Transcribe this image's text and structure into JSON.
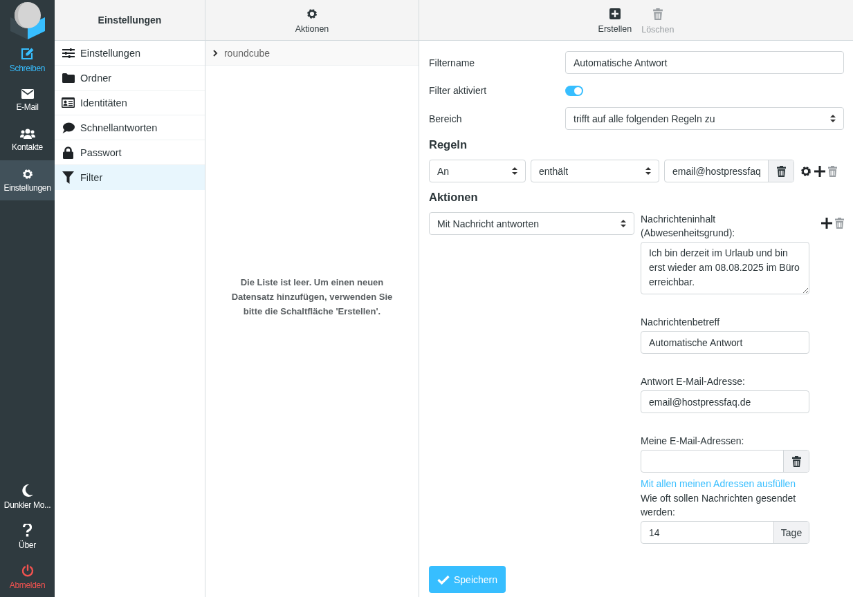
{
  "nav": {
    "top": [
      {
        "kind": "compose",
        "label": "Schreiben",
        "selected": false
      },
      {
        "kind": "mail",
        "label": "E-Mail",
        "selected": false
      },
      {
        "kind": "contacts",
        "label": "Kontakte",
        "selected": false
      },
      {
        "kind": "settings",
        "label": "Einstellungen",
        "selected": true
      }
    ],
    "bottom": [
      {
        "kind": "darkmode",
        "label": "Dunkler Mo..."
      },
      {
        "kind": "about",
        "label": "Über"
      },
      {
        "kind": "logout",
        "label": "Abmelden"
      }
    ]
  },
  "settings": {
    "title": "Einstellungen",
    "items": [
      {
        "kind": "prefs",
        "label": "Einstellungen",
        "selected": false
      },
      {
        "kind": "folders",
        "label": "Ordner",
        "selected": false
      },
      {
        "kind": "identities",
        "label": "Identitäten",
        "selected": false
      },
      {
        "kind": "responses",
        "label": "Schnellantworten",
        "selected": false
      },
      {
        "kind": "password",
        "label": "Passwort",
        "selected": false
      },
      {
        "kind": "filter",
        "label": "Filter",
        "selected": true
      }
    ]
  },
  "filtersets": {
    "toolbar": {
      "label": "Aktionen"
    },
    "items": [
      {
        "label": "roundcube",
        "selected": false
      }
    ],
    "empty_message": "Die Liste ist leer. Um einen neuen Datensatz hinzufügen, verwenden Sie bitte die Schaltfläche 'Erstellen'."
  },
  "toolbar": [
    {
      "kind": "create",
      "label": "Erstellen",
      "disabled": false
    },
    {
      "kind": "delete",
      "label": "Löschen",
      "disabled": true
    }
  ],
  "form": {
    "name": {
      "label": "Filtername",
      "value": "Automatische Antwort"
    },
    "enabled": {
      "label": "Filter aktiviert",
      "on": true
    },
    "scope": {
      "label": "Bereich",
      "value": "trifft auf alle folgenden Regeln zu"
    },
    "rules_heading": "Regeln",
    "rule": {
      "header": "An",
      "operator": "enthält",
      "value": "email@hostpressfaq",
      "delete_disabled": true
    },
    "actions_heading": "Aktionen",
    "action": {
      "type": "Mit Nachricht antworten",
      "delete_disabled": true,
      "body_label": "Nachrichteninhalt (Abwesenheitsgrund):",
      "body": "Ich bin derzeit im Urlaub und bin erst wieder am 08.08.2025 im Büro erreichbar.",
      "subject_label": "Nachrichtenbetreff",
      "subject": "Automatische Antwort",
      "from_label": "Antwort E-Mail-Adresse:",
      "from": "email@hostpressfaq.de",
      "addresses_label": "Meine E-Mail-Adressen:",
      "fill_link": "Mit allen meinen Adressen ausfüllen",
      "days_label": "Wie oft sollen Nachrichten gesendet werden:",
      "days": "14",
      "days_unit": "Tage"
    },
    "save": "Speichern"
  }
}
